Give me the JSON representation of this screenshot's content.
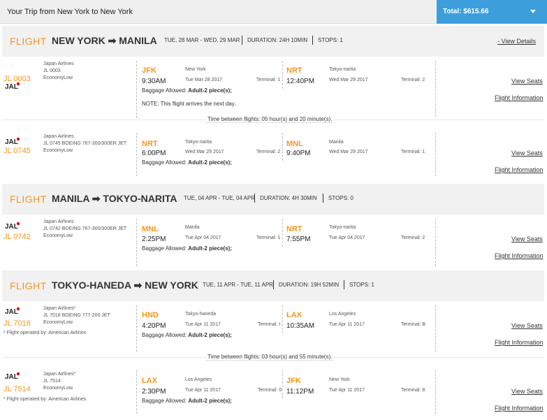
{
  "header": {
    "trip_title": "Your Trip from New York to New York",
    "total_label": "Total: $615.66"
  },
  "flight_word": "FLIGHT",
  "flights": [
    {
      "route": "NEW YORK ➡ MANILA",
      "dates": "TUE, 28 MAR - WED, 29 MAR",
      "duration": "DURATION: 24H 10MIN",
      "stops": "STOPS: 1",
      "view_details": "- View Details"
    },
    {
      "route": "MANILA ➡ TOKYO-NARITA",
      "dates": "TUE, 04 APR - TUE, 04 APR",
      "duration": "DURATION: 4H 30MIN",
      "stops": "STOPS: 0"
    },
    {
      "route": "TOKYO-HANEDA ➡ NEW YORK",
      "dates": "TUE, 11 APR - TUE, 11 APR",
      "duration": "DURATION: 19H 52MIN",
      "stops": "STOPS: 1"
    }
  ],
  "segments": [
    {
      "logo": "JAL",
      "flight_no": "JL 0003",
      "airline": "Japan Airlines",
      "equip": "JL 0003",
      "cabin": "EconomyLow",
      "dep_code": "JFK",
      "dep_time": "9:30AM",
      "dep_city": "New York",
      "dep_date": "Tue Mar 28 2017",
      "dep_term": "Terminal: 1",
      "arr_code": "NRT",
      "arr_time": "12:40PM",
      "arr_city": "Tokyo-narita",
      "arr_date": "Wed Mar 29 2017",
      "arr_term": "Terminal: 2",
      "bag_label": "Baggage Allowed:",
      "bag_value": "Adult-2 piece(s);",
      "note": "NOTE: This flight arrives the next day.",
      "view_seats": "View Seats",
      "flight_info": "Flight Information"
    },
    {
      "logo": "JAL",
      "flight_no": "JL 0745",
      "airline": "Japan Airlines",
      "equip": "JL 0745 BOEING 767-300/300ER JET",
      "cabin": "EconomyLow",
      "dep_code": "NRT",
      "dep_time": "6:00PM",
      "dep_city": "Tokyo-narita",
      "dep_date": "Wed Mar 29 2017",
      "dep_term": "Terminal: 2",
      "arr_code": "MNL",
      "arr_time": "9:40PM",
      "arr_city": "Manila",
      "arr_date": "Wed Mar 29 2017",
      "arr_term": "Terminal: 1",
      "bag_label": "Baggage Allowed:",
      "bag_value": "Adult-2 piece(s);",
      "view_seats": "View Seats",
      "flight_info": "Flight Information"
    },
    {
      "logo": "JAL",
      "flight_no": "JL 0742",
      "airline": "Japan Airlines",
      "equip": "JL 0742 BOEING 767-300/300ER JET",
      "cabin": "EconomyLow",
      "dep_code": "MNL",
      "dep_time": "2:25PM",
      "dep_city": "Manila",
      "dep_date": "Tue Apr 04 2017",
      "dep_term": "Terminal: 1",
      "arr_code": "NRT",
      "arr_time": "7:55PM",
      "arr_city": "Tokyo-narita",
      "arr_date": "Tue Apr 04 2017",
      "arr_term": "Terminal: 2",
      "bag_label": "Baggage Allowed:",
      "bag_value": "Adult-2 piece(s);",
      "view_seats": "View Seats",
      "flight_info": "Flight Information"
    },
    {
      "logo": "JAL",
      "flight_no": "JL 7018",
      "airline": "Japan Airlines*",
      "equip": "JL 7018 BOEING 777-200 JET",
      "cabin": "EconomyLow",
      "operated_by": "* Flight operated by: American Airlines",
      "dep_code": "HND",
      "dep_time": "4:20PM",
      "dep_city": "Tokyo-haneda",
      "dep_date": "Tue Apr 11 2017",
      "dep_term": "Terminal: I",
      "arr_code": "LAX",
      "arr_time": "10:35AM",
      "arr_city": "Los Angeles",
      "arr_date": "Tue Apr 11 2017",
      "arr_term": "Terminal: B",
      "bag_label": "Baggage Allowed:",
      "bag_value": "Adult-2 piece(s);",
      "view_seats": "View Seats",
      "flight_info": "Flight Information"
    },
    {
      "logo": "JAL",
      "flight_no": "JL 7514",
      "airline": "Japan Airlines*",
      "equip": "JL 7514",
      "cabin": "EconomyLow",
      "operated_by": "* Flight operated by: American Airlines",
      "dep_code": "LAX",
      "dep_time": "2:30PM",
      "dep_city": "Los Angeles",
      "dep_date": "Tue Apr 11 2017",
      "dep_term": "Terminal: 0",
      "arr_code": "JFK",
      "arr_time": "11:12PM",
      "arr_city": "New York",
      "arr_date": "Tue Apr 11 2017",
      "arr_term": "Terminal: 8",
      "bag_label": "Baggage Allowed:",
      "bag_value": "Adult-2 piece(s);",
      "view_seats": "View Seats",
      "flight_info": "Flight Information"
    }
  ],
  "layovers": [
    "Time between flights: 05 hour(s) and 20 minute(s).",
    "Time between flights: 03 hour(s) and 55 minute(s)."
  ]
}
